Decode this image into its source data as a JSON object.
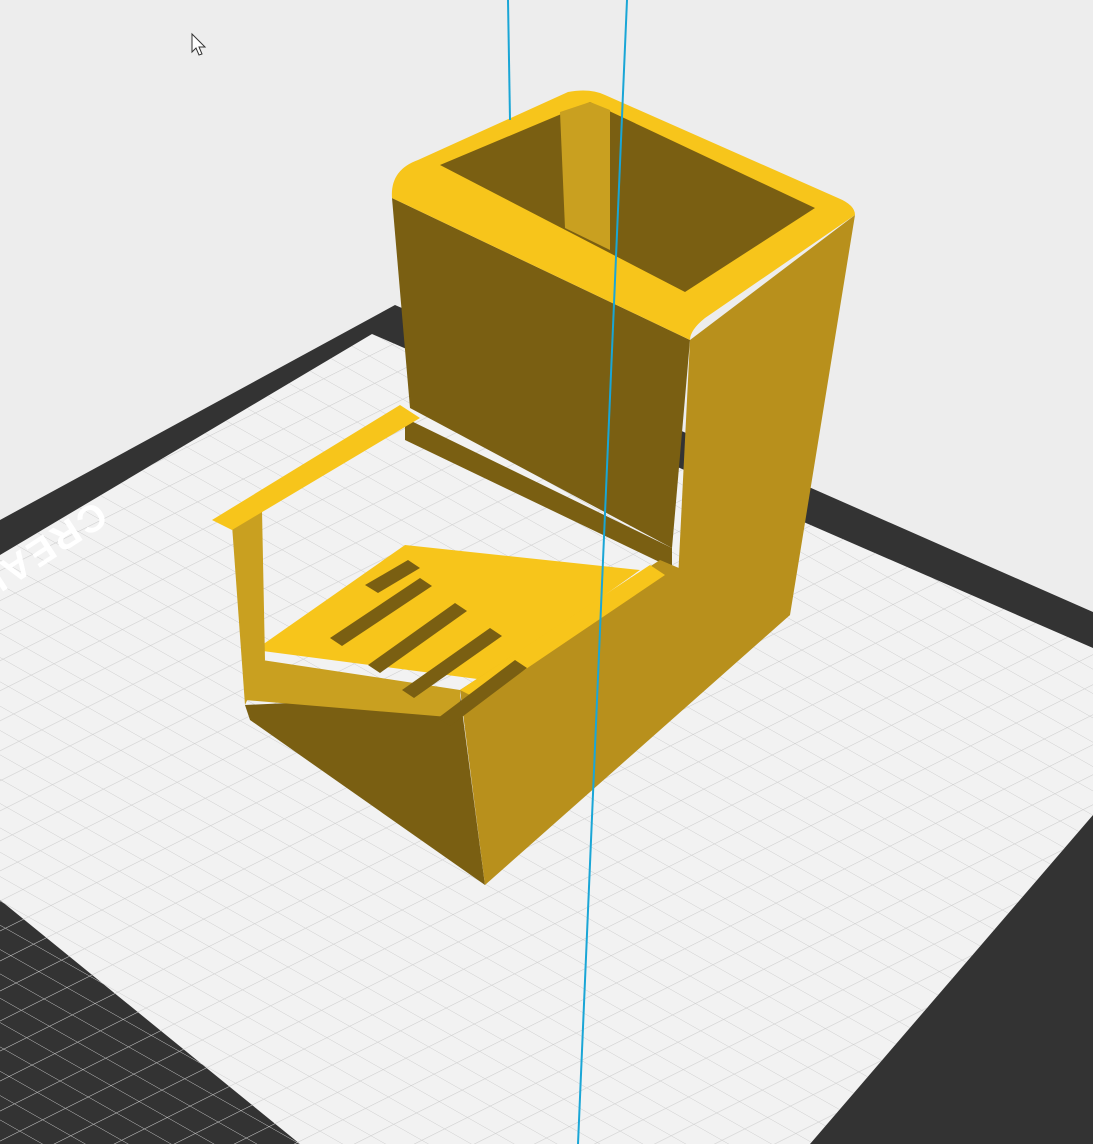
{
  "viewport": {
    "background_color": "#ededed",
    "bed": {
      "brand_label": "CREALITY",
      "frame_color": "#333333",
      "surface_color": "#f2f2f2",
      "grid_color": "#cccccc"
    },
    "model": {
      "color_top": "#f7c51b",
      "color_front": "#b8901c",
      "color_side": "#7a5f12"
    },
    "guide_line_color": "#1aa6d6",
    "cursor_icon": "mouse-pointer-icon"
  }
}
